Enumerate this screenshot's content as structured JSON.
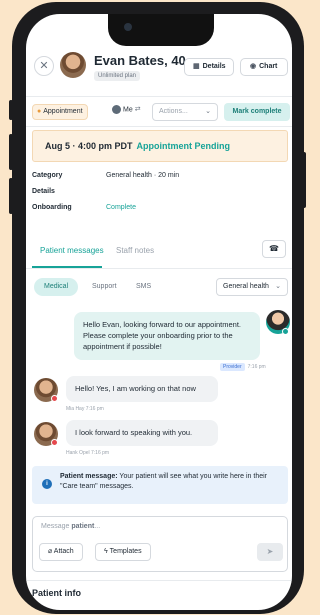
{
  "header": {
    "patient_name": "Evan Bates, 40",
    "plan": "Unlimited plan",
    "close_icon": "close-icon",
    "details_label": "Details",
    "chart_label": "Chart"
  },
  "actions": {
    "appointment_badge": "Appointment",
    "assignee": "Me",
    "actions_placeholder": "Actions...",
    "mark_complete": "Mark complete"
  },
  "appointment": {
    "datetime": "Aug 5 · 4:00 pm PDT",
    "status": "Appointment Pending"
  },
  "info": {
    "category_label": "Category",
    "category_value": "General health · 20 min",
    "details_label": "Details",
    "onboarding_label": "Onboarding",
    "onboarding_value": "Complete"
  },
  "tabs": {
    "patient_messages": "Patient messages",
    "staff_notes": "Staff notes"
  },
  "filters": {
    "chips": [
      "Medical",
      "Support",
      "SMS"
    ],
    "team": "General health"
  },
  "messages": [
    {
      "text": "Hello Evan, looking forward to our appointment. Please complete your onboarding prior to the appointment if possible!",
      "tag": "Provider",
      "time": "7:16 pm"
    },
    {
      "text": "Hello! Yes, I am working on that now",
      "author": "Mia Hay",
      "time": "7:16 pm"
    },
    {
      "text": "I look forward to speaking with you.",
      "author": "Hank Opel",
      "time": "7:16 pm"
    }
  ],
  "notice": {
    "bold": "Patient message:",
    "text": " Your patient will see what you write here in their \"Care team\" messages."
  },
  "composer": {
    "placeholder_prefix": "Message ",
    "placeholder_target": "patient",
    "placeholder_suffix": "...",
    "attach": "Attach",
    "templates": "Templates"
  },
  "section": {
    "title": "Patient info"
  },
  "colors": {
    "accent": "#17a398",
    "background": "#fbe6c9",
    "appointment_bg": "#fdf1e1"
  }
}
